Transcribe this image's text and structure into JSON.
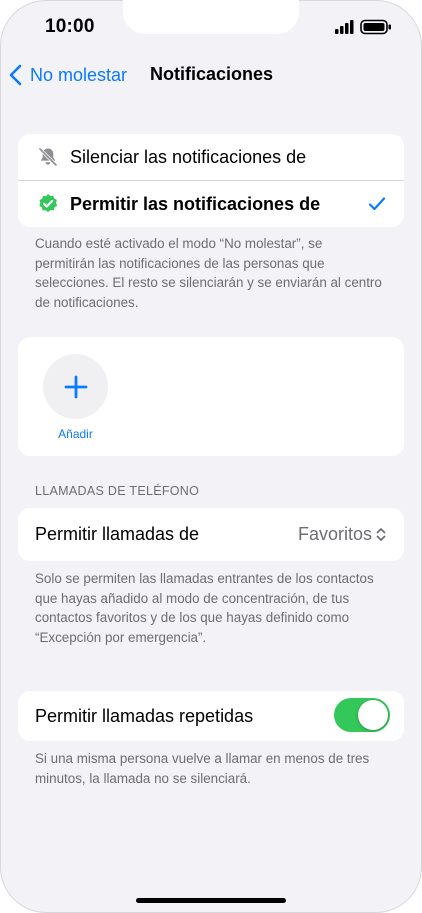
{
  "status_bar": {
    "time": "10:00"
  },
  "nav": {
    "back_label": "No molestar",
    "title": "Notificaciones"
  },
  "notifications": {
    "options": [
      {
        "label": "Silenciar las notificaciones de",
        "selected": false,
        "icon": "bell-slash-icon"
      },
      {
        "label": "Permitir las notificaciones de",
        "selected": true,
        "icon": "green-checkmark-seal-icon"
      }
    ],
    "footnote": "Cuando esté activado el modo “No molestar”, se permitirán las notificaciones de las personas que selecciones. El resto se silenciarán y se enviarán al centro de notificaciones."
  },
  "add_people": {
    "label": "Añadir"
  },
  "calls": {
    "section_header": "LLAMADAS DE TELÉFONO",
    "allow_calls_from_label": "Permitir llamadas de",
    "allow_calls_from_value": "Favoritos",
    "footnote": "Solo se permiten las llamadas entrantes de los contactos que hayas añadido al modo de concentración, de tus contactos favoritos y de los que hayas definido como “Excepción por emergencia”.",
    "repeated_calls_label": "Permitir llamadas repetidas",
    "repeated_calls_enabled": true,
    "repeated_calls_footnote": "Si una misma persona vuelve a llamar en menos de tres minutos, la llamada no se silenciará."
  },
  "colors": {
    "accent": "#0a7aff",
    "toggle_on": "#34c759",
    "background": "#f2f2f7",
    "secondary_text": "#6d6d72"
  }
}
